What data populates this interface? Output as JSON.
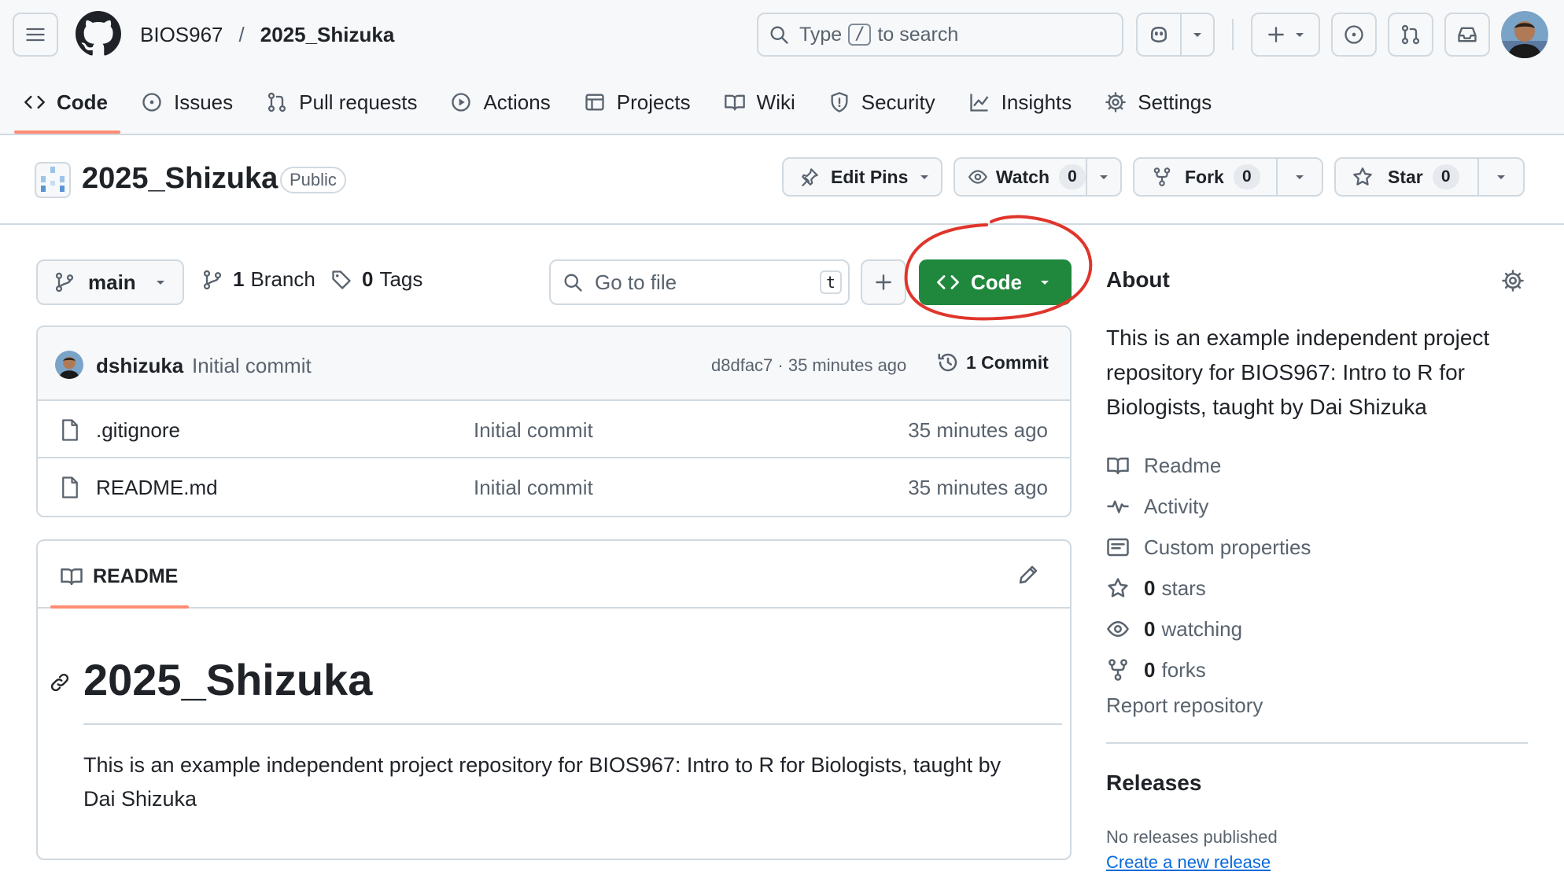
{
  "header": {
    "owner": "BIOS967",
    "separator": "/",
    "repo": "2025_Shizuka",
    "search_before": "Type",
    "search_key": "/",
    "search_after": "to search"
  },
  "tabs": [
    {
      "label": "Code",
      "icon": "code-icon",
      "selected": true
    },
    {
      "label": "Issues",
      "icon": "issue-icon"
    },
    {
      "label": "Pull requests",
      "icon": "pull-request-icon"
    },
    {
      "label": "Actions",
      "icon": "play-icon"
    },
    {
      "label": "Projects",
      "icon": "table-icon"
    },
    {
      "label": "Wiki",
      "icon": "book-icon"
    },
    {
      "label": "Security",
      "icon": "shield-icon"
    },
    {
      "label": "Insights",
      "icon": "graph-icon"
    },
    {
      "label": "Settings",
      "icon": "gear-icon"
    }
  ],
  "repo_header": {
    "title": "2025_Shizuka",
    "visibility": "Public",
    "edit_pins": "Edit Pins",
    "watch": "Watch",
    "watch_count": "0",
    "fork": "Fork",
    "fork_count": "0",
    "star": "Star",
    "star_count": "0"
  },
  "browser": {
    "branch": "main",
    "branch_count": "1",
    "branch_label": "Branch",
    "tag_count": "0",
    "tag_label": "Tags",
    "goto_placeholder": "Go to file",
    "goto_key": "t",
    "code_button": "Code"
  },
  "commit": {
    "user": "dshizuka",
    "message": "Initial commit",
    "meta": "d8dfac7 · 35 minutes ago",
    "count": "1 Commit"
  },
  "files": [
    {
      "name": ".gitignore",
      "commit": "Initial commit",
      "age": "35 minutes ago"
    },
    {
      "name": "README.md",
      "commit": "Initial commit",
      "age": "35 minutes ago"
    }
  ],
  "readme": {
    "tab": "README",
    "heading": "2025_Shizuka",
    "body": "This is an example independent project repository for BIOS967: Intro to R for Biologists, taught by Dai Shizuka"
  },
  "about": {
    "title": "About",
    "description": "This is an example independent project repository for BIOS967: Intro to R for Biologists, taught by Dai Shizuka",
    "items": [
      {
        "icon": "book-icon",
        "label": "Readme"
      },
      {
        "icon": "pulse-icon",
        "label": "Activity"
      },
      {
        "icon": "note-icon",
        "label": "Custom properties"
      },
      {
        "icon": "star-icon",
        "count": "0",
        "label": "stars"
      },
      {
        "icon": "eye-icon",
        "count": "0",
        "label": "watching"
      },
      {
        "icon": "fork-icon",
        "count": "0",
        "label": "forks"
      }
    ],
    "report": "Report repository"
  },
  "releases": {
    "title": "Releases",
    "none": "No releases published",
    "create": "Create a new release"
  },
  "colors": {
    "code_button": "#1f883d",
    "accent_underline": "#fd8c73",
    "annotation": "#e0352b",
    "link": "#0969da"
  }
}
